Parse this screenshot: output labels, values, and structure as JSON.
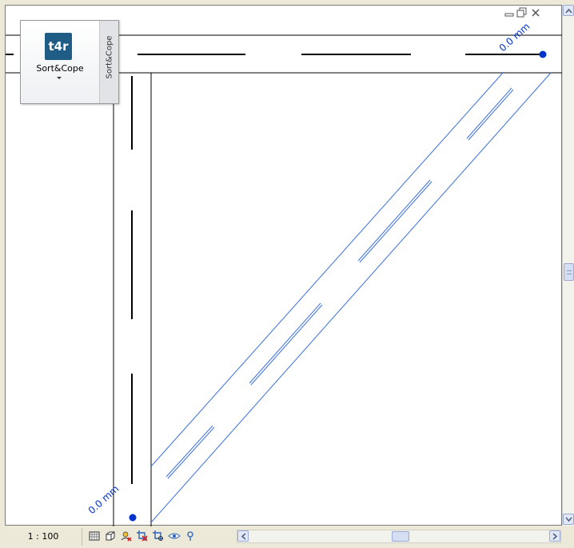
{
  "panel": {
    "logo_text": "t4r",
    "button_label": "Sort&Cope",
    "side_title": "Sort&Cope"
  },
  "drawing": {
    "dimension_top": "0.0 mm",
    "dimension_bottom": "0.0 mm",
    "line_color": "#000000",
    "selected_color": "#3a6fe0",
    "grip_color": "#0033cc"
  },
  "statusbar": {
    "scale": "1 : 100",
    "tools": [
      "detail-level-icon",
      "visual-style-icon",
      "sun-path-icon",
      "crop-view-icon",
      "crop-region-icon",
      "hide-isolate-icon",
      "reveal-hidden-icon"
    ]
  },
  "window_controls": [
    "minimize-icon",
    "restore-icon",
    "close-icon"
  ]
}
